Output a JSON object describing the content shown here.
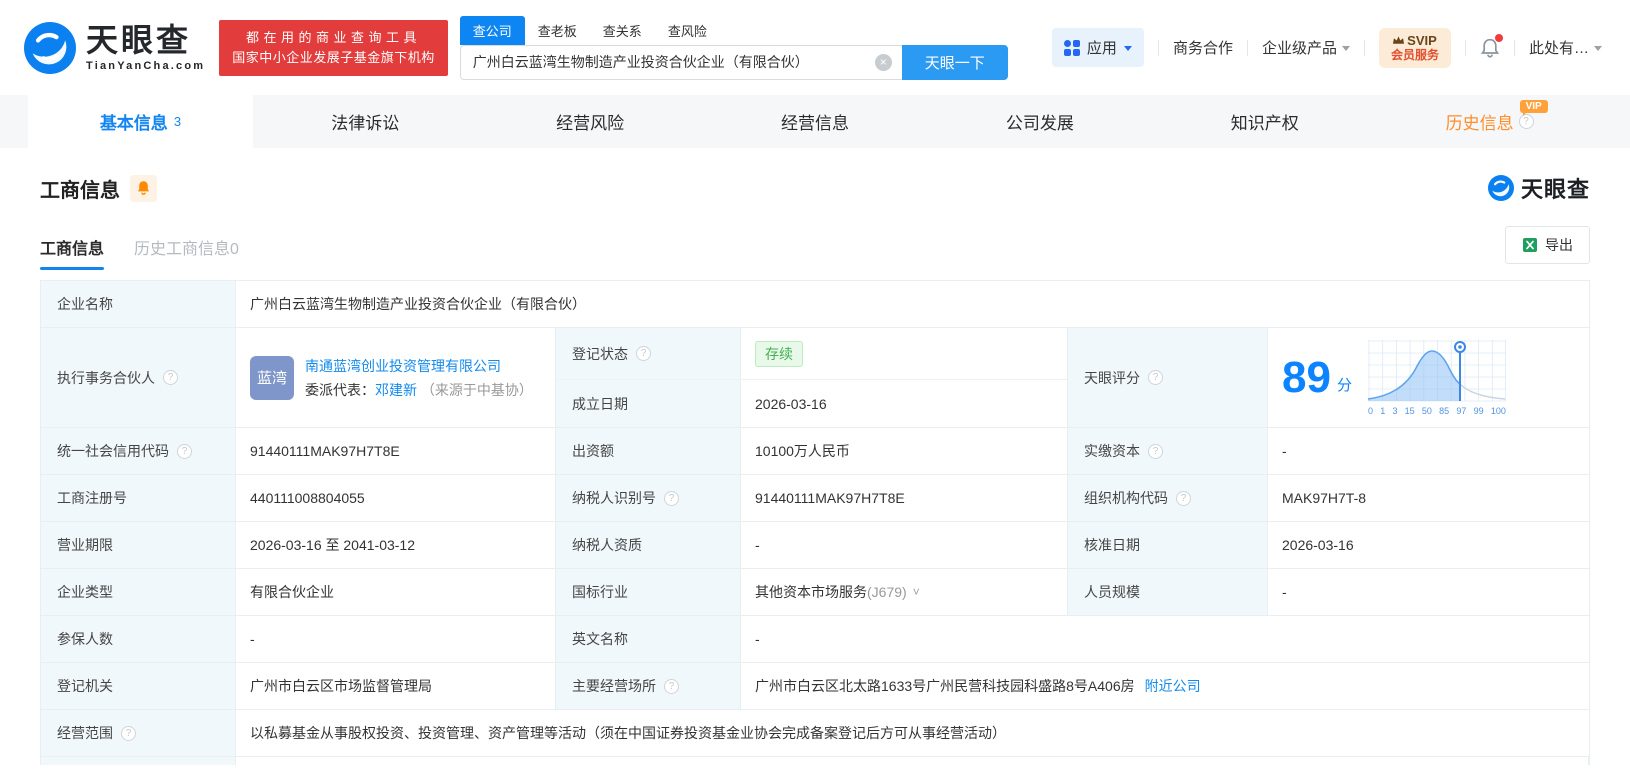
{
  "colors": {
    "brand_blue": "#0d84ff",
    "link_blue": "#128bed",
    "promo_red": "#e23c3c",
    "status_green": "#45b054",
    "vip_orange": "#ffa13a"
  },
  "icons": {
    "help": "?",
    "clear": "×",
    "chevron_down": "˅"
  },
  "header": {
    "logo": {
      "brand": "天眼查",
      "domain": "TianYanCha.com"
    },
    "promo": {
      "line1": "都在用的商业查询工具",
      "line2": "国家中小企业发展子基金旗下机构"
    },
    "search": {
      "tabs": [
        {
          "label": "查公司"
        },
        {
          "label": "查老板"
        },
        {
          "label": "查关系"
        },
        {
          "label": "查风险"
        }
      ],
      "value": "广州白云蓝湾生物制造产业投资合伙企业（有限合伙）",
      "button": "天眼一下"
    },
    "actions": {
      "apps": "应用",
      "cooperation": "商务合作",
      "enterprise": "企业级产品",
      "svip_line1": "SVIP",
      "svip_line2": "会员服务",
      "user": "此处有…"
    }
  },
  "nav": {
    "tabs": [
      {
        "label": "基本信息",
        "count": "3"
      },
      {
        "label": "法律诉讼"
      },
      {
        "label": "经营风险"
      },
      {
        "label": "经营信息"
      },
      {
        "label": "公司发展"
      },
      {
        "label": "知识产权"
      },
      {
        "label": "历史信息",
        "vip": "VIP"
      }
    ]
  },
  "section": {
    "title": "工商信息",
    "watermark": "天眼查",
    "subtabs": {
      "current": "工商信息",
      "history": "历史工商信息",
      "history_count": "0"
    },
    "export_label": "导出"
  },
  "table": {
    "company_name": {
      "label": "企业名称",
      "value": "广州白云蓝湾生物制造产业投资合伙企业（有限合伙）"
    },
    "partner": {
      "label": "执行事务合伙人",
      "avatar": "蓝湾",
      "company": "南通蓝湾创业投资管理有限公司",
      "rep_label": "委派代表：",
      "rep_name": "邓建新",
      "rep_source": "（来源于中基协）"
    },
    "reg_status": {
      "label": "登记状态",
      "value": "存续"
    },
    "est_date": {
      "label": "成立日期",
      "value": "2026-03-16"
    },
    "score": {
      "label": "天眼评分",
      "value": "89",
      "unit": "分"
    },
    "credit_code": {
      "label": "统一社会信用代码",
      "value": "91440111MAK97H7T8E"
    },
    "capital": {
      "label": "出资额",
      "value": "10100万人民币"
    },
    "paid_capital": {
      "label": "实缴资本",
      "value": "-"
    },
    "reg_number": {
      "label": "工商注册号",
      "value": "440111008804055"
    },
    "taxpayer_id": {
      "label": "纳税人识别号",
      "value": "91440111MAK97H7T8E"
    },
    "org_code": {
      "label": "组织机构代码",
      "value": "MAK97H7T-8"
    },
    "business_term": {
      "label": "营业期限",
      "value": "2026-03-16 至 2041-03-12"
    },
    "taxpayer_quality": {
      "label": "纳税人资质",
      "value": "-"
    },
    "approval_date": {
      "label": "核准日期",
      "value": "2026-03-16"
    },
    "company_type": {
      "label": "企业类型",
      "value": "有限合伙企业"
    },
    "industry": {
      "label": "国标行业",
      "value": "其他资本市场服务",
      "code": "(J679)"
    },
    "staff_size": {
      "label": "人员规模",
      "value": "-"
    },
    "insured_count": {
      "label": "参保人数",
      "value": "-"
    },
    "english_name": {
      "label": "英文名称",
      "value": "-"
    },
    "reg_authority": {
      "label": "登记机关",
      "value": "广州市白云区市场监督管理局"
    },
    "business_site": {
      "label": "主要经营场所",
      "value": "广州市白云区北太路1633号广州民营科技园科盛路8号A406房",
      "nearby": "附近公司"
    },
    "business_scope": {
      "label": "经营范围",
      "value": "以私募基金从事股权投资、投资管理、资产管理等活动（须在中国证券投资基金业协会完成备案登记后方可从事经营活动）"
    }
  },
  "score_chart": {
    "type": "area",
    "score": 89,
    "unit": "分",
    "ticks": [
      0,
      1,
      3,
      15,
      50,
      85,
      97,
      99,
      100
    ],
    "marker_value": 89
  }
}
